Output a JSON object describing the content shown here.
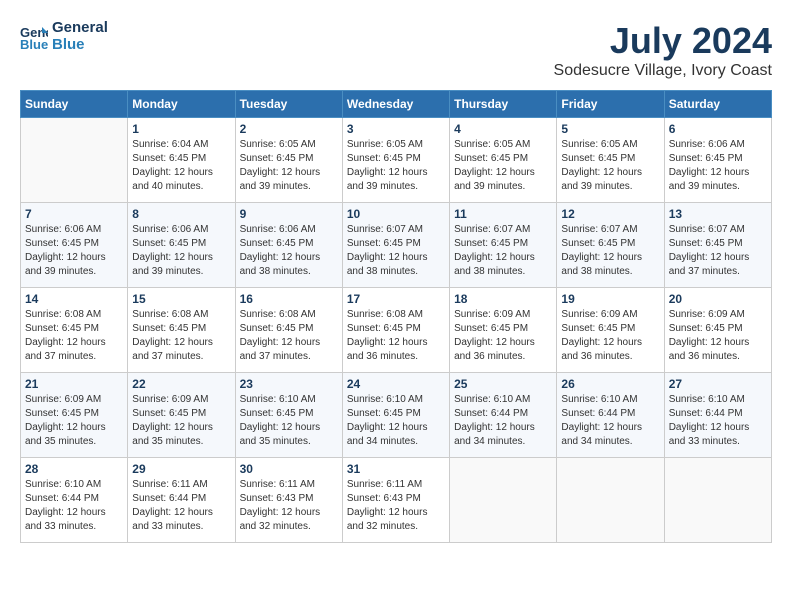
{
  "logo": {
    "line1": "General",
    "line2": "Blue"
  },
  "title": "July 2024",
  "location": "Sodesucre Village, Ivory Coast",
  "days_of_week": [
    "Sunday",
    "Monday",
    "Tuesday",
    "Wednesday",
    "Thursday",
    "Friday",
    "Saturday"
  ],
  "weeks": [
    [
      {
        "day": "",
        "info": ""
      },
      {
        "day": "1",
        "info": "Sunrise: 6:04 AM\nSunset: 6:45 PM\nDaylight: 12 hours\nand 40 minutes."
      },
      {
        "day": "2",
        "info": "Sunrise: 6:05 AM\nSunset: 6:45 PM\nDaylight: 12 hours\nand 39 minutes."
      },
      {
        "day": "3",
        "info": "Sunrise: 6:05 AM\nSunset: 6:45 PM\nDaylight: 12 hours\nand 39 minutes."
      },
      {
        "day": "4",
        "info": "Sunrise: 6:05 AM\nSunset: 6:45 PM\nDaylight: 12 hours\nand 39 minutes."
      },
      {
        "day": "5",
        "info": "Sunrise: 6:05 AM\nSunset: 6:45 PM\nDaylight: 12 hours\nand 39 minutes."
      },
      {
        "day": "6",
        "info": "Sunrise: 6:06 AM\nSunset: 6:45 PM\nDaylight: 12 hours\nand 39 minutes."
      }
    ],
    [
      {
        "day": "7",
        "info": "Sunrise: 6:06 AM\nSunset: 6:45 PM\nDaylight: 12 hours\nand 39 minutes."
      },
      {
        "day": "8",
        "info": "Sunrise: 6:06 AM\nSunset: 6:45 PM\nDaylight: 12 hours\nand 39 minutes."
      },
      {
        "day": "9",
        "info": "Sunrise: 6:06 AM\nSunset: 6:45 PM\nDaylight: 12 hours\nand 38 minutes."
      },
      {
        "day": "10",
        "info": "Sunrise: 6:07 AM\nSunset: 6:45 PM\nDaylight: 12 hours\nand 38 minutes."
      },
      {
        "day": "11",
        "info": "Sunrise: 6:07 AM\nSunset: 6:45 PM\nDaylight: 12 hours\nand 38 minutes."
      },
      {
        "day": "12",
        "info": "Sunrise: 6:07 AM\nSunset: 6:45 PM\nDaylight: 12 hours\nand 38 minutes."
      },
      {
        "day": "13",
        "info": "Sunrise: 6:07 AM\nSunset: 6:45 PM\nDaylight: 12 hours\nand 37 minutes."
      }
    ],
    [
      {
        "day": "14",
        "info": "Sunrise: 6:08 AM\nSunset: 6:45 PM\nDaylight: 12 hours\nand 37 minutes."
      },
      {
        "day": "15",
        "info": "Sunrise: 6:08 AM\nSunset: 6:45 PM\nDaylight: 12 hours\nand 37 minutes."
      },
      {
        "day": "16",
        "info": "Sunrise: 6:08 AM\nSunset: 6:45 PM\nDaylight: 12 hours\nand 37 minutes."
      },
      {
        "day": "17",
        "info": "Sunrise: 6:08 AM\nSunset: 6:45 PM\nDaylight: 12 hours\nand 36 minutes."
      },
      {
        "day": "18",
        "info": "Sunrise: 6:09 AM\nSunset: 6:45 PM\nDaylight: 12 hours\nand 36 minutes."
      },
      {
        "day": "19",
        "info": "Sunrise: 6:09 AM\nSunset: 6:45 PM\nDaylight: 12 hours\nand 36 minutes."
      },
      {
        "day": "20",
        "info": "Sunrise: 6:09 AM\nSunset: 6:45 PM\nDaylight: 12 hours\nand 36 minutes."
      }
    ],
    [
      {
        "day": "21",
        "info": "Sunrise: 6:09 AM\nSunset: 6:45 PM\nDaylight: 12 hours\nand 35 minutes."
      },
      {
        "day": "22",
        "info": "Sunrise: 6:09 AM\nSunset: 6:45 PM\nDaylight: 12 hours\nand 35 minutes."
      },
      {
        "day": "23",
        "info": "Sunrise: 6:10 AM\nSunset: 6:45 PM\nDaylight: 12 hours\nand 35 minutes."
      },
      {
        "day": "24",
        "info": "Sunrise: 6:10 AM\nSunset: 6:45 PM\nDaylight: 12 hours\nand 34 minutes."
      },
      {
        "day": "25",
        "info": "Sunrise: 6:10 AM\nSunset: 6:44 PM\nDaylight: 12 hours\nand 34 minutes."
      },
      {
        "day": "26",
        "info": "Sunrise: 6:10 AM\nSunset: 6:44 PM\nDaylight: 12 hours\nand 34 minutes."
      },
      {
        "day": "27",
        "info": "Sunrise: 6:10 AM\nSunset: 6:44 PM\nDaylight: 12 hours\nand 33 minutes."
      }
    ],
    [
      {
        "day": "28",
        "info": "Sunrise: 6:10 AM\nSunset: 6:44 PM\nDaylight: 12 hours\nand 33 minutes."
      },
      {
        "day": "29",
        "info": "Sunrise: 6:11 AM\nSunset: 6:44 PM\nDaylight: 12 hours\nand 33 minutes."
      },
      {
        "day": "30",
        "info": "Sunrise: 6:11 AM\nSunset: 6:43 PM\nDaylight: 12 hours\nand 32 minutes."
      },
      {
        "day": "31",
        "info": "Sunrise: 6:11 AM\nSunset: 6:43 PM\nDaylight: 12 hours\nand 32 minutes."
      },
      {
        "day": "",
        "info": ""
      },
      {
        "day": "",
        "info": ""
      },
      {
        "day": "",
        "info": ""
      }
    ]
  ]
}
